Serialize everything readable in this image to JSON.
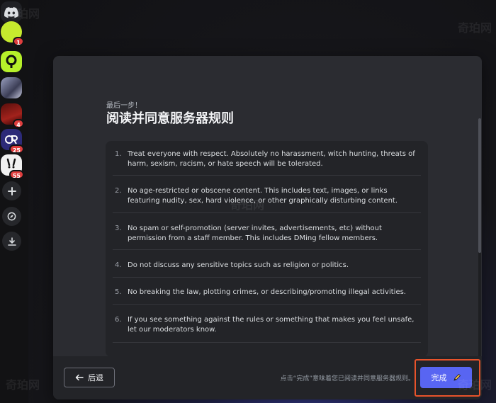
{
  "sidebar": {
    "servers": [
      {
        "name": "server-green",
        "color": "#c6ea2e",
        "badge": "1"
      },
      {
        "name": "server-key",
        "color": "#b6f02a",
        "badge": ""
      },
      {
        "name": "server-anime",
        "color": "#6c6f8e",
        "badge": ""
      },
      {
        "name": "server-red",
        "color": "#a3221c",
        "badge": "4"
      },
      {
        "name": "server-gr",
        "color": "#2c2a78",
        "badge": "25"
      },
      {
        "name": "server-bunny",
        "color": "#f0f0f0",
        "badge": "55"
      }
    ],
    "actions": [
      {
        "name": "add-server-button",
        "icon": "plus-icon"
      },
      {
        "name": "explore-button",
        "icon": "compass-icon"
      },
      {
        "name": "download-button",
        "icon": "download-icon"
      }
    ]
  },
  "modal": {
    "subtitle": "最后一步！",
    "title": "阅读并同意服务器规则",
    "rules": [
      {
        "num": "1.",
        "text": "Treat everyone with respect. Absolutely no harassment, witch hunting, threats of harm, sexism, racism, or hate speech will be tolerated."
      },
      {
        "num": "2.",
        "text": "No age-restricted or obscene content. This includes text, images, or links featuring nudity, sex, hard violence, or other graphically disturbing content."
      },
      {
        "num": "3.",
        "text": "No spam or self-promotion (server invites, advertisements, etc) without permission from a staff member. This includes DMing fellow members."
      },
      {
        "num": "4.",
        "text": "Do not discuss any sensitive topics such as religion or politics."
      },
      {
        "num": "5.",
        "text": "No breaking the law, plotting crimes, or describing/promoting illegal activities."
      },
      {
        "num": "6.",
        "text": "If you see something against the rules or something that makes you feel unsafe, let our moderators know."
      }
    ],
    "footer": {
      "back_label": "后退",
      "notice": "点击“完成”意味着您已阅读并同意服务器规则。",
      "done_label": "完成"
    }
  },
  "watermark": "奇珀网",
  "colors": {
    "accent": "#5865f2",
    "highlight": "#e8532b",
    "badge": "#e03e3e"
  }
}
